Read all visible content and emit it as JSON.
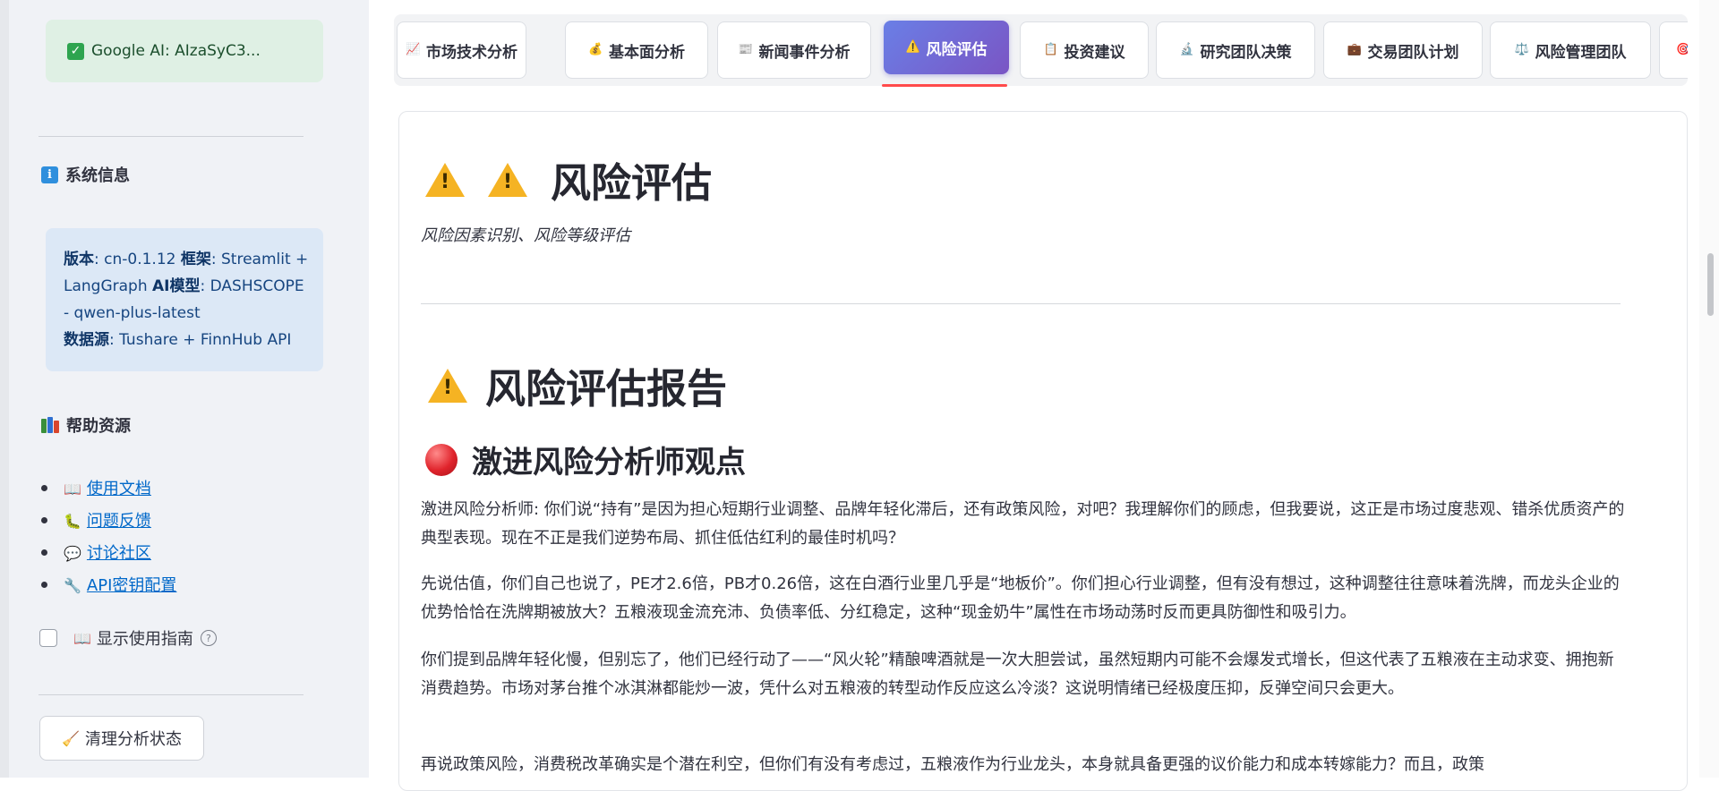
{
  "sidebar": {
    "google_status": "Google AI: AIzaSyC3...",
    "system_info": {
      "heading": "系统信息",
      "version_label": "版本",
      "version_value": ": cn-0.1.12 ",
      "framework_label": "框架",
      "framework_value": ": Streamlit + LangGraph ",
      "ai_label": "AI模型",
      "ai_value": ": DASHSCOPE - qwen-plus-latest",
      "datasource_label": "数据源",
      "datasource_value": ": Tushare + FinnHub API"
    },
    "help": {
      "heading": "帮助资源",
      "links": [
        {
          "icon": "📖",
          "icon_name": "book-icon",
          "label": "使用文档"
        },
        {
          "icon": "🐛",
          "icon_name": "bug-icon",
          "label": "问题反馈"
        },
        {
          "icon": "💬",
          "icon_name": "speech-bubble-icon",
          "label": "讨论社区"
        },
        {
          "icon": "🔧",
          "icon_name": "wrench-icon",
          "label": "API密钥配置"
        }
      ]
    },
    "guide_checkbox": {
      "icon": "📖",
      "label": "显示使用指南",
      "checked": false
    },
    "clear_button": {
      "icon": "🧹",
      "label": "清理分析状态"
    }
  },
  "tabs": [
    {
      "icon": "📈",
      "icon_name": "chart-up-icon",
      "label": "市场技术分析",
      "active": false
    },
    {
      "icon": "💰",
      "icon_name": "money-bag-icon",
      "label": "基本面分析",
      "active": false
    },
    {
      "icon": "📰",
      "icon_name": "newspaper-icon",
      "label": "新闻事件分析",
      "active": false
    },
    {
      "icon": "⚠️",
      "icon_name": "warning-icon",
      "label": "风险评估",
      "active": true
    },
    {
      "icon": "📋",
      "icon_name": "clipboard-icon",
      "label": "投资建议",
      "active": false
    },
    {
      "icon": "🔬",
      "icon_name": "microscope-icon",
      "label": "研究团队决策",
      "active": false
    },
    {
      "icon": "💼",
      "icon_name": "briefcase-icon",
      "label": "交易团队计划",
      "active": false
    },
    {
      "icon": "⚖️",
      "icon_name": "scales-icon",
      "label": "风险管理团队",
      "active": false
    },
    {
      "icon": "🎯",
      "icon_name": "target-icon",
      "label": "",
      "active": false
    }
  ],
  "main": {
    "title": "风险评估",
    "subtitle": "风险因素识别、风险等级评估",
    "report_title": "风险评估报告",
    "section_title": "激进风险分析师观点",
    "paragraphs": [
      "激进风险分析师: 你们说“持有”是因为担心短期行业调整、品牌年轻化滞后，还有政策风险，对吧？我理解你们的顾虑，但我要说，这正是市场过度悲观、错杀优质资产的典型表现。现在不正是我们逆势布局、抓住低估红利的最佳时机吗？",
      "先说估值，你们自己也说了，PE才2.6倍，PB才0.26倍，这在白酒行业里几乎是“地板价”。你们担心行业调整，但有没有想过，这种调整往往意味着洗牌，而龙头企业的优势恰恰在洗牌期被放大？五粮液现金流充沛、负债率低、分红稳定，这种“现金奶牛”属性在市场动荡时反而更具防御性和吸引力。",
      "你们提到品牌年轻化慢，但别忘了，他们已经行动了——“风火轮”精酿啤酒就是一次大胆尝试，虽然短期内可能不会爆发式增长，但这代表了五粮液在主动求变、拥抱新消费趋势。市场对茅台推个冰淇淋都能炒一波，凭什么对五粮液的转型动作反应这么冷淡？这说明情绪已经极度压抑，反弹空间只会更大。",
      "再说政策风险，消费税改革确实是个潜在利空，但你们有没有考虑过，五粮液作为行业龙头，本身就具备更强的议价能力和成本转嫁能力？而且，政策"
    ]
  }
}
